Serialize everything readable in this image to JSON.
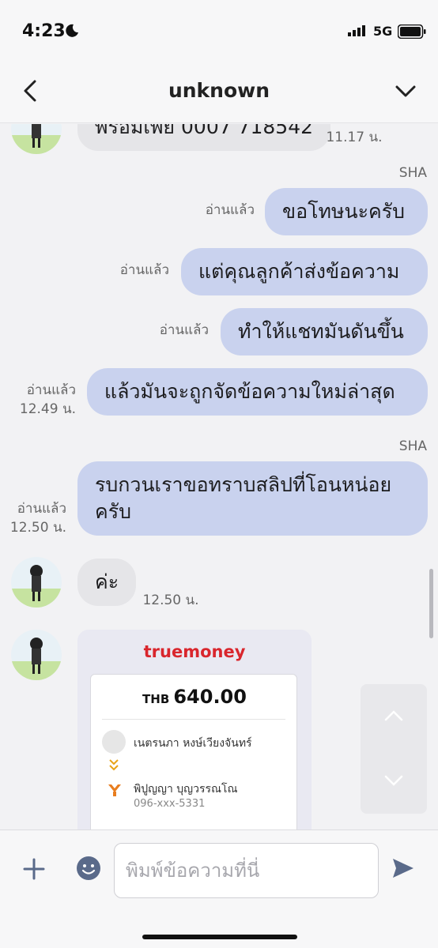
{
  "status_bar": {
    "time": "4:23",
    "network": "5G",
    "icons": [
      "moon-icon",
      "signal-icon",
      "battery-icon"
    ]
  },
  "header": {
    "title": "unknown",
    "back_icon": "chevron-left-icon",
    "menu_icon": "chevron-down-icon"
  },
  "messages": [
    {
      "direction": "in",
      "text": "พร้อมเพย์ 0007 718542",
      "time": "11.17 น."
    },
    {
      "direction": "out",
      "sender": "SHA",
      "text": "ขอโทษนะครับ",
      "read": "อ่านแล้ว"
    },
    {
      "direction": "out",
      "text": "แต่คุณลูกค้าส่งข้อความ",
      "read": "อ่านแล้ว"
    },
    {
      "direction": "out",
      "text": "ทำให้แชทมันดันขึ้น",
      "read": "อ่านแล้ว"
    },
    {
      "direction": "out",
      "text": "แล้วมันจะถูกจัดข้อความใหม่ล่าสุด",
      "read": "อ่านแล้ว",
      "time": "12.49 น."
    },
    {
      "direction": "out",
      "sender": "SHA",
      "text_line1": "รบกวนเราขอทราบสลิปที่โอนหน่อย",
      "text_line2": "ครับ",
      "read": "อ่านแล้ว",
      "time": "12.50 น."
    },
    {
      "direction": "in",
      "text": "ค่ะ",
      "time": "12.50 น."
    }
  ],
  "receipt": {
    "brand": "truemoney",
    "currency": "THB",
    "amount": "640.00",
    "sender_name": "เนตรนภา หงษ์เวียงจันทร์",
    "recipient_name": "พิปูญญา บุญวรรณโณ",
    "recipient_phone": "096-xxx-5331"
  },
  "input": {
    "placeholder": "พิมพ์ข้อความที่นี่"
  },
  "colors": {
    "outgoing_bubble": "#c9d2ee",
    "incoming_bubble": "#e5e5e8",
    "brand_red": "#d9262d",
    "send_icon": "#5a6a8a"
  }
}
